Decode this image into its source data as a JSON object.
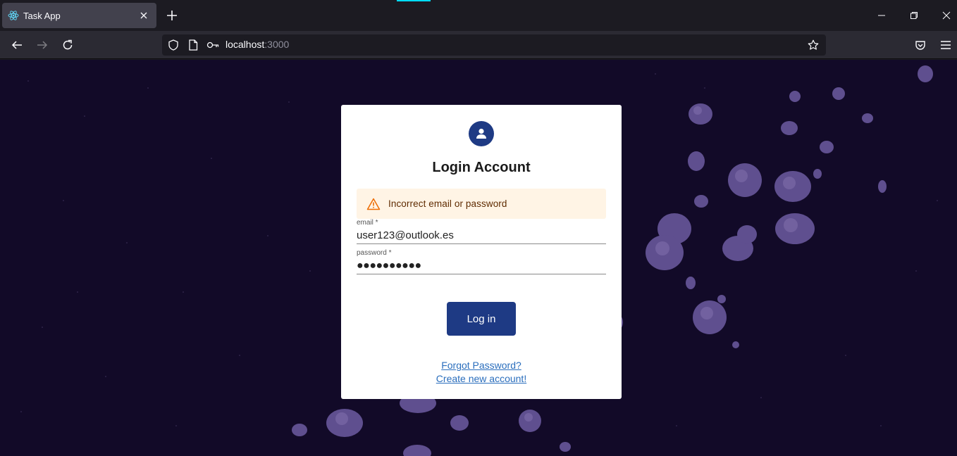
{
  "browser": {
    "tab": {
      "title": "Task App",
      "favicon": "react-atom-icon"
    },
    "address": {
      "host": "localhost",
      "port": ":3000"
    }
  },
  "login": {
    "title": "Login Account",
    "alert": {
      "icon": "warning-icon",
      "message": "Incorrect email or password",
      "color": "#ed6c02"
    },
    "email": {
      "label": "email *",
      "value": "user123@outlook.es"
    },
    "password": {
      "label": "password *",
      "value": "●●●●●●●●●●"
    },
    "submit_label": "Log in",
    "forgot_label": "Forgot Password?",
    "create_label": "Create new account!"
  },
  "colors": {
    "primary": "#1e3a84",
    "background": "#120a28",
    "link": "#2a6ebd",
    "alert_bg": "#fff4e5"
  }
}
